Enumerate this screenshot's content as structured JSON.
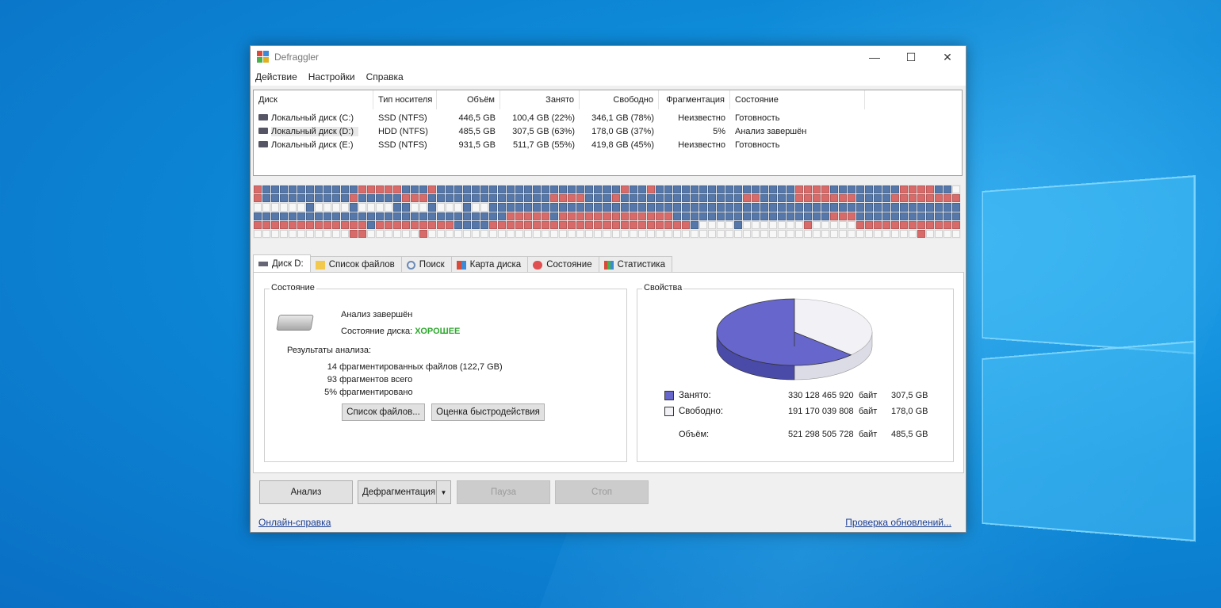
{
  "window": {
    "title": "Defraggler"
  },
  "menu": [
    "Действие",
    "Настройки",
    "Справка"
  ],
  "columns": [
    "Диск",
    "Тип носителя",
    "Объём",
    "Занято",
    "Свободно",
    "Фрагментация",
    "Состояние"
  ],
  "drives": [
    {
      "name": "Локальный диск (C:)",
      "type": "SSD (NTFS)",
      "size": "446,5 GB",
      "used": "100,4 GB (22%)",
      "free": "346,1 GB (78%)",
      "frag": "Неизвестно",
      "status": "Готовность"
    },
    {
      "name": "Локальный диск (D:)",
      "type": "HDD (NTFS)",
      "size": "485,5 GB",
      "used": "307,5 GB (63%)",
      "free": "178,0 GB (37%)",
      "frag": "5%",
      "status": "Анализ завершён"
    },
    {
      "name": "Локальный диск (E:)",
      "type": "SSD (NTFS)",
      "size": "931,5 GB",
      "used": "511,7 GB (55%)",
      "free": "419,8 GB (45%)",
      "frag": "Неизвестно",
      "status": "Готовность"
    }
  ],
  "tabs": [
    "Диск D:",
    "Список файлов",
    "Поиск",
    "Карта диска",
    "Состояние",
    "Статистика"
  ],
  "status_group": {
    "label": "Состояние",
    "analysis": "Анализ завершён",
    "disk_state_label": "Состояние диска:",
    "disk_state_value": "ХОРОШЕЕ",
    "results_label": "Результаты анализа:",
    "results": [
      {
        "num": "14",
        "text": "фрагментированных файлов (122,7 GB)"
      },
      {
        "num": "93",
        "text": "фрагментов всего"
      },
      {
        "num": "5%",
        "text": "фрагментировано"
      }
    ],
    "file_list_btn": "Список файлов...",
    "benchmark_btn": "Оценка быстродействия"
  },
  "props_group": {
    "label": "Свойства",
    "used_label": "Занято:",
    "used_bytes": "330 128 465 920",
    "used_unit": "байт",
    "used_gb": "307,5 GB",
    "free_label": "Свободно:",
    "free_bytes": "191 170 039 808",
    "free_unit": "байт",
    "free_gb": "178,0 GB",
    "total_label": "Объём:",
    "total_bytes": "521 298 505 728",
    "total_unit": "байт",
    "total_gb": "485,5 GB",
    "used_fraction": 0.63,
    "used_color": "#6666cc",
    "free_color": "#f2f2f6"
  },
  "buttons": {
    "analyze": "Анализ",
    "defrag": "Дефрагментация",
    "pause": "Пауза",
    "stop": "Стоп"
  },
  "footer": {
    "help_link": "Онлайн-справка",
    "update_link": "Проверка обновлений..."
  },
  "blockmap_colors": {
    "used": "#5577aa",
    "fragmented": "#d86a6a",
    "free": "#f7f7f7"
  }
}
